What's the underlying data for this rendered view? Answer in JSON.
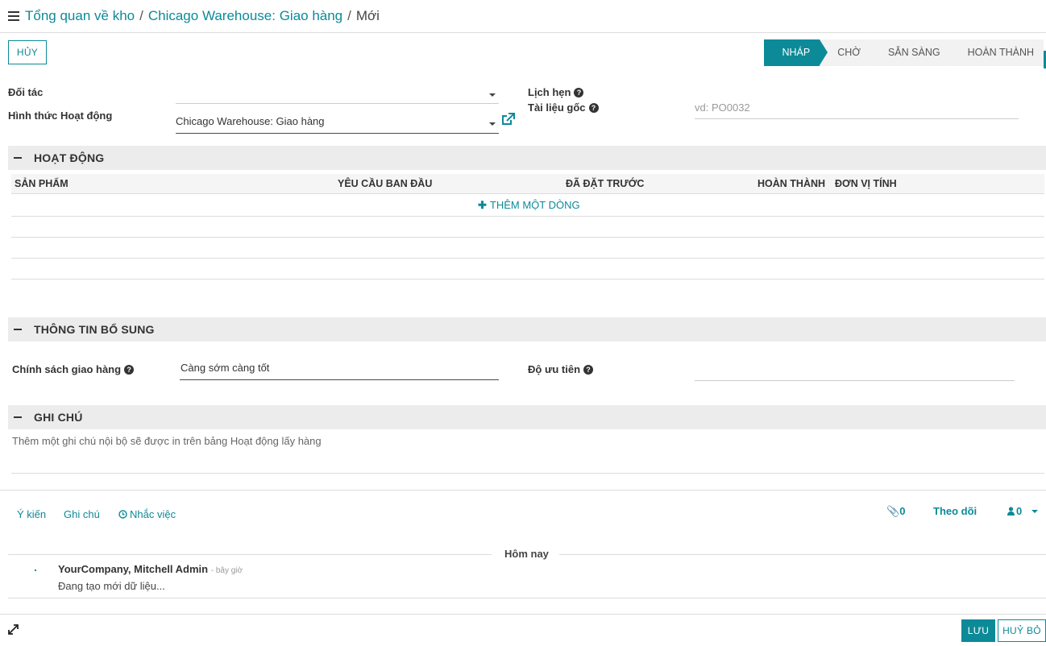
{
  "breadcrumb": {
    "items": [
      "Tổng quan về kho",
      "Chicago Warehouse: Giao hàng"
    ],
    "current": "Mới",
    "separator": "/"
  },
  "toolbar": {
    "cancel_label": "HỦY"
  },
  "statusbar": {
    "stages": [
      "NHÁP",
      "CHỜ",
      "SẴN SÀNG",
      "HOÀN THÀNH"
    ],
    "active": "NHÁP"
  },
  "form": {
    "partner_label": "Đối tác",
    "partner_value": "",
    "operation_type_label": "Hình thức Hoạt động",
    "operation_type_value": "Chicago Warehouse: Giao hàng",
    "scheduled_label": "Lịch hẹn",
    "source_doc_label": "Tài liệu gốc",
    "source_doc_placeholder": "vd: PO0032"
  },
  "operations": {
    "title": "HOẠT ĐỘNG",
    "columns": [
      "SẢN PHẨM",
      "YÊU CẦU BAN ĐẦU",
      "ĐÃ ĐẶT TRƯỚC",
      "HOÀN THÀNH",
      "ĐƠN VỊ TÍNH"
    ],
    "add_line": "THÊM MỘT DÒNG"
  },
  "extra": {
    "title": "THÔNG TIN BỔ SUNG",
    "shipping_policy_label": "Chính sách giao hàng",
    "shipping_policy_value": "Càng sớm càng tốt",
    "priority_label": "Độ ưu tiên"
  },
  "notes": {
    "title": "GHI CHÚ",
    "placeholder": "Thêm một ghi chú nội bộ sẽ được in trên bảng Hoạt động lấy hàng"
  },
  "chatter": {
    "tabs": [
      "Ý kiến",
      "Ghi chú",
      "Nhắc việc"
    ],
    "attachments_count": "0",
    "follow_label": "Theo dõi",
    "followers_count": "0",
    "date_separator": "Hôm nay",
    "message": {
      "author": "YourCompany, Mitchell Admin",
      "time": "- bây giờ",
      "body": "Đang tạo mới dữ liệu..."
    }
  },
  "footer": {
    "save_label": "LƯU",
    "discard_label": "HUỶ BỎ"
  },
  "colors": {
    "accent": "#0d8a98",
    "section_bg": "#ececec"
  }
}
